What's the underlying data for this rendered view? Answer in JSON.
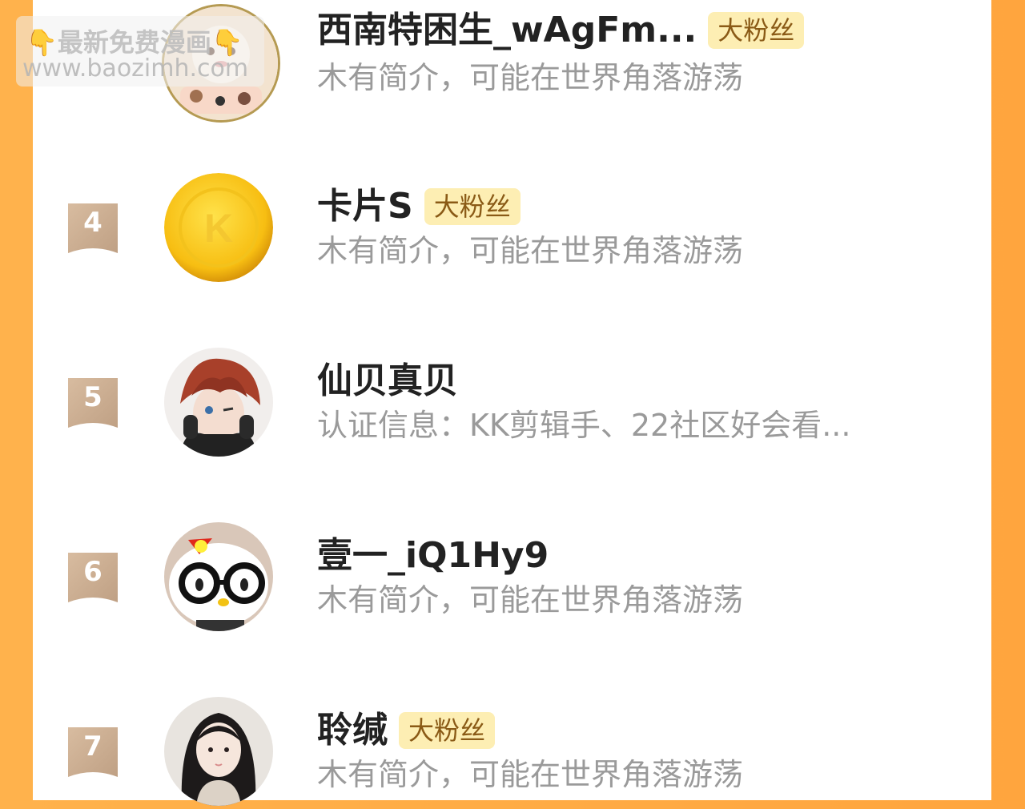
{
  "watermark": {
    "line1": "👇最新免费漫画👇",
    "line2": "www.baozimh.com"
  },
  "colors": {
    "bg_orange": "#ffa53e",
    "badge": "#c9ab90",
    "fan_tag_bg": "#fdeeb3",
    "name": "#222222",
    "desc": "#9a9a9a"
  },
  "fans": [
    {
      "rank": "",
      "name": "西南特困生_wAgFm...",
      "tag": "大粉丝",
      "desc": "木有简介，可能在世界角落游荡",
      "avatar_icon": "cartoon-avatar-icon"
    },
    {
      "rank": "4",
      "name": "卡片S",
      "tag": "大粉丝",
      "desc": "木有简介，可能在世界角落游荡",
      "avatar_icon": "gold-coin-k-avatar-icon"
    },
    {
      "rank": "5",
      "name": "仙贝真贝",
      "tag": "",
      "desc": "认证信息：KK剪辑手、22社区好会看...",
      "avatar_icon": "anime-boy-avatar-icon"
    },
    {
      "rank": "6",
      "name": "壹一_iQ1Hy9",
      "tag": "",
      "desc": "木有简介，可能在世界角落游荡",
      "avatar_icon": "hello-kitty-glasses-avatar-icon"
    },
    {
      "rank": "7",
      "name": "聆缄",
      "tag": "大粉丝",
      "desc": "木有简介，可能在世界角落游荡",
      "avatar_icon": "girl-photo-avatar-icon"
    }
  ]
}
